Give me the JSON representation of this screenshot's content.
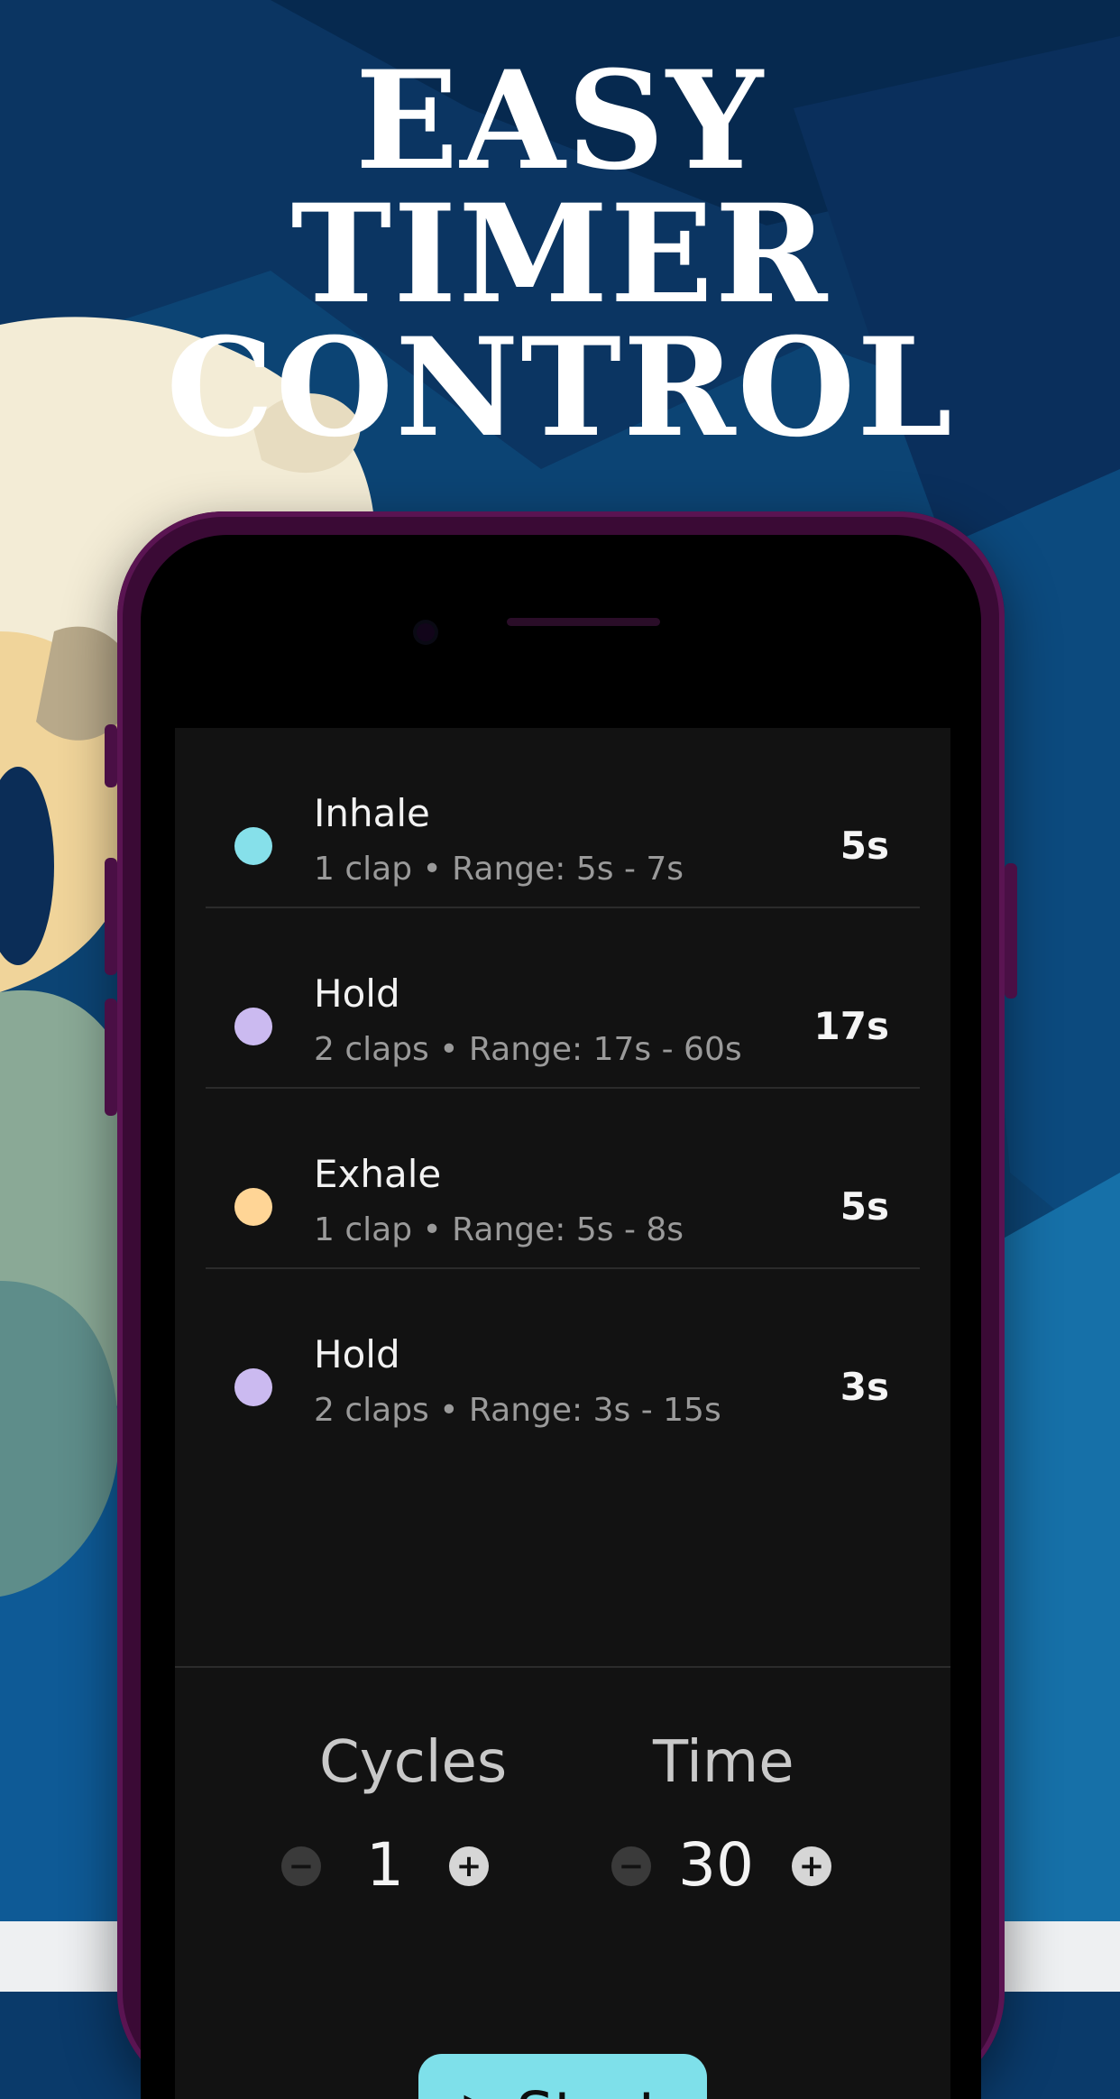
{
  "headline": [
    "Easy",
    "Timer",
    "Control"
  ],
  "phases": [
    {
      "name": "Inhale",
      "detail": "1 clap • Range: 5s - 7s",
      "value": "5s",
      "color": "#86e0ea"
    },
    {
      "name": "Hold",
      "detail": "2 claps • Range: 17s - 60s",
      "value": "17s",
      "color": "#cbbaf0"
    },
    {
      "name": "Exhale",
      "detail": "1 clap • Range: 5s - 8s",
      "value": "5s",
      "color": "#ffd596"
    },
    {
      "name": "Hold",
      "detail": "2 claps • Range: 3s - 15s",
      "value": "3s",
      "color": "#cbbaf0"
    }
  ],
  "controls": {
    "cycles_label": "Cycles",
    "cycles_value": "1",
    "time_label": "Time",
    "time_value": "30",
    "minus_symbol": "−",
    "plus_symbol": "+"
  },
  "start": {
    "icon": "play-icon",
    "glyph": "▶",
    "label": "Start"
  },
  "colors": {
    "accent": "#7ee0ea",
    "screen_bg": "#121212",
    "phone_frame": "#3a0a35"
  }
}
